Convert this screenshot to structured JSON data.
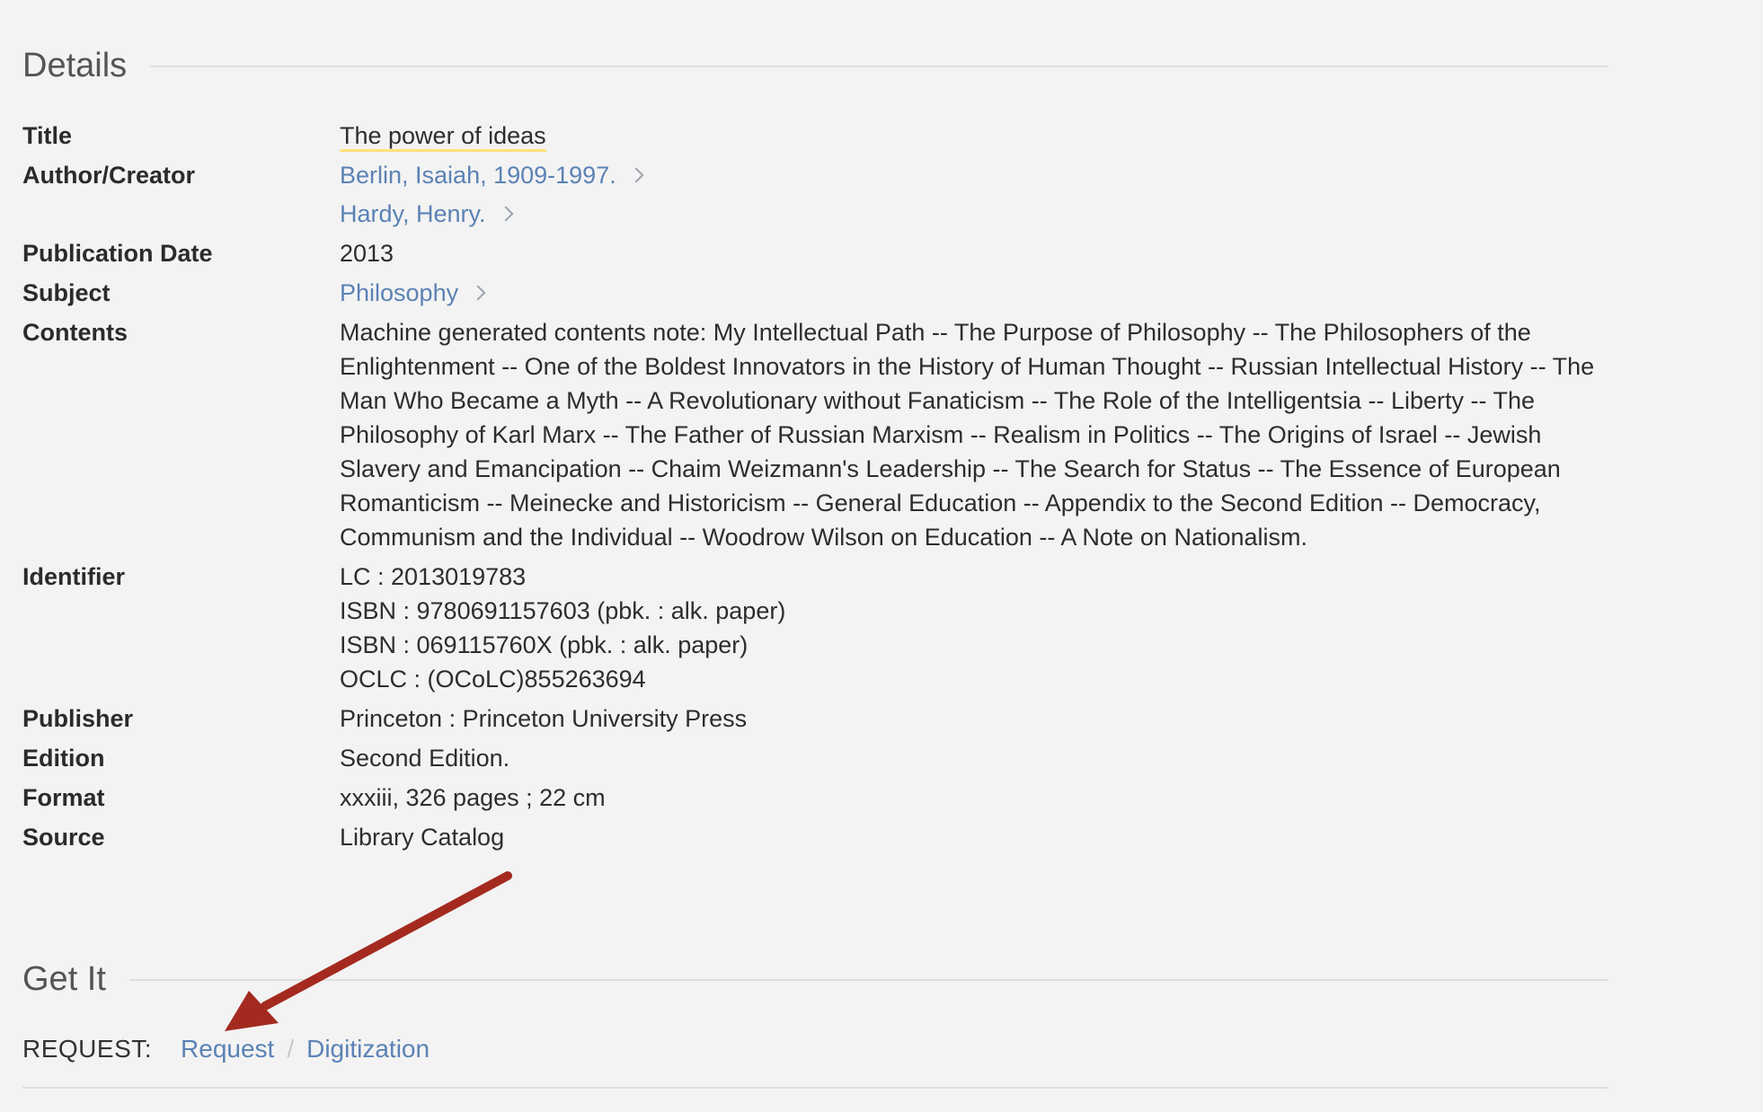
{
  "details": {
    "heading": "Details",
    "title_label": "Title",
    "title_value": "The power of ideas",
    "author_label": "Author/Creator",
    "authors": [
      "Berlin, Isaiah, 1909-1997.",
      "Hardy, Henry."
    ],
    "pubdate_label": "Publication Date",
    "pubdate_value": "2013",
    "subject_label": "Subject",
    "subject_value": "Philosophy",
    "contents_label": "Contents",
    "contents_value": "Machine generated contents note: My Intellectual Path -- The Purpose of Philosophy -- The Philosophers of the Enlightenment -- One of the Boldest Innovators in the History of Human Thought -- Russian Intellectual History -- The Man Who Became a Myth -- A Revolutionary without Fanaticism -- The Role of the Intelligentsia -- Liberty -- The Philosophy of Karl Marx -- The Father of Russian Marxism -- Realism in Politics -- The Origins of Israel -- Jewish Slavery and Emancipation -- Chaim Weizmann's Leadership -- The Search for Status -- The Essence of European Romanticism -- Meinecke and Historicism -- General Education -- Appendix to the Second Edition -- Democracy, Communism and the Individual -- Woodrow Wilson on Education -- A Note on Nationalism.",
    "identifier_label": "Identifier",
    "identifiers": [
      "LC : 2013019783",
      "ISBN : 9780691157603 (pbk. : alk. paper)",
      "ISBN : 069115760X (pbk. : alk. paper)",
      "OCLC : (OCoLC)855263694"
    ],
    "publisher_label": "Publisher",
    "publisher_value": "Princeton : Princeton University Press",
    "edition_label": "Edition",
    "edition_value": "Second Edition.",
    "format_label": "Format",
    "format_value": "xxxiii, 326 pages ; 22 cm",
    "source_label": "Source",
    "source_value": "Library Catalog"
  },
  "getit": {
    "heading": "Get It",
    "request_label": "REQUEST:",
    "request_link": "Request",
    "separator": "/",
    "digitization_link": "Digitization"
  },
  "colors": {
    "link": "#5b82b5",
    "highlight": "#ffe27a",
    "arrow": "#a42a1f",
    "background": "#f3f3f3"
  },
  "icons": {
    "chevron": "chevron-right-icon",
    "arrow": "red-annotation-arrow"
  }
}
